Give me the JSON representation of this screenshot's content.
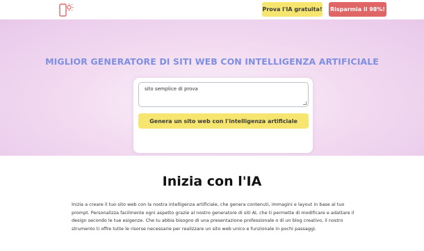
{
  "header": {
    "logo_icon": "phone-sun-icon",
    "accent_color": "#e06565",
    "try_ai_label": "Prova l'IA gratuita!",
    "save_label": "Risparmia il 98%!"
  },
  "hero": {
    "title": "MIGLIOR GENERATORE DI SITI WEB CON INTELLIGENZA ARTIFICIALE",
    "prompt_value": "sito semplice di prova",
    "generate_label": "Genera un sito web con l'intelligenza artificiale"
  },
  "intro": {
    "title": "Inizia con l'IA",
    "text": "Inizia a creare il tuo sito web con la nostra intelligenza artificiale, che genera contenuti, immagini e layout in base al tuo prompt. Personalizza facilmente ogni aspetto grazie al nostro generatore di siti AI, che ti permette di modificare e adattare il design secondo le tue esigenze. Che tu abbia bisogno di una presentazione professionale o di un blog creativo, il nostro strumento ti offre tutte le risorse necessarie per realizzare un sito web unico e funzionale in pochi passaggi."
  }
}
